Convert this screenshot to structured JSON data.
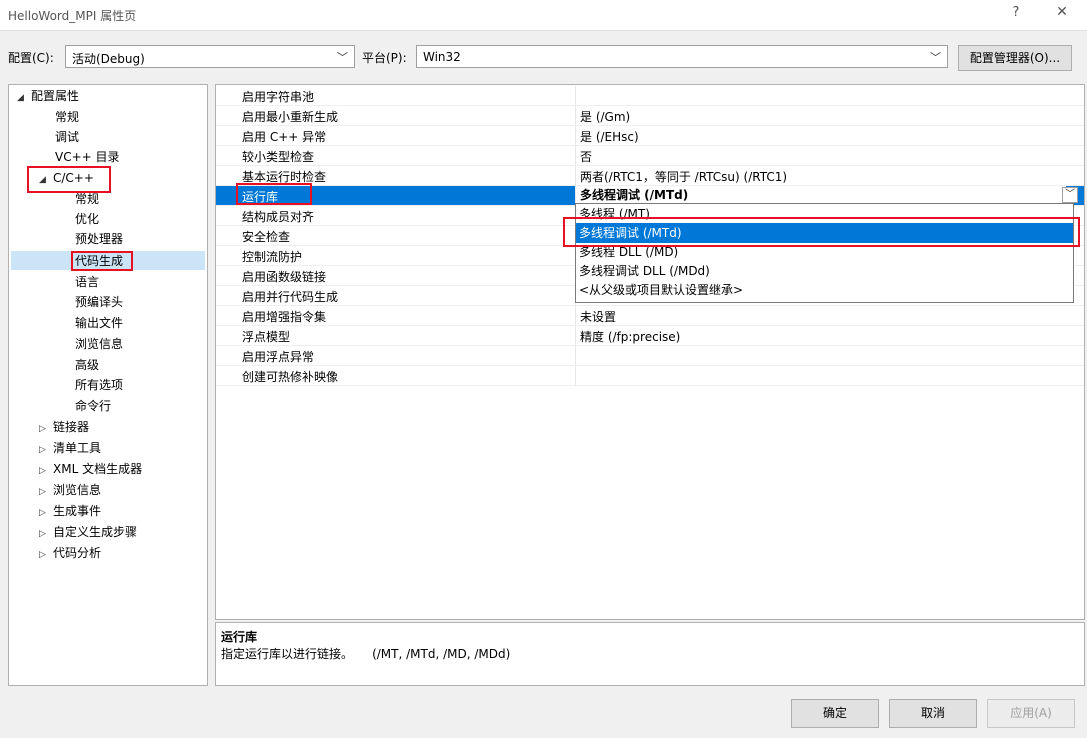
{
  "window": {
    "title": "HelloWord_MPI 属性页",
    "help": "?",
    "close": "✕"
  },
  "config_bar": {
    "config_label": "配置(C):",
    "config_value": "活动(Debug)",
    "platform_label": "平台(P):",
    "platform_value": "Win32",
    "manager_button": "配置管理器(O)..."
  },
  "tree": {
    "root": "配置属性",
    "general": "常规",
    "debugging": "调试",
    "vc_dirs": "VC++ 目录",
    "cpp": "C/C++",
    "cpp_children": [
      "常规",
      "优化",
      "预处理器",
      "代码生成",
      "语言",
      "预编译头",
      "输出文件",
      "浏览信息",
      "高级",
      "所有选项",
      "命令行"
    ],
    "collapsed": [
      "链接器",
      "清单工具",
      "XML 文档生成器",
      "浏览信息",
      "生成事件",
      "自定义生成步骤",
      "代码分析"
    ],
    "selected": "代码生成"
  },
  "grid": {
    "rows": [
      {
        "name": "启用字符串池",
        "value": ""
      },
      {
        "name": "启用最小重新生成",
        "value": "是 (/Gm)"
      },
      {
        "name": "启用 C++ 异常",
        "value": "是 (/EHsc)"
      },
      {
        "name": "较小类型检查",
        "value": "否"
      },
      {
        "name": "基本运行时检查",
        "value": "两者(/RTC1，等同于 /RTCsu) (/RTC1)"
      },
      {
        "name": "运行库",
        "value": "多线程调试 (/MTd)"
      },
      {
        "name": "结构成员对齐",
        "value": ""
      },
      {
        "name": "安全检查",
        "value": ""
      },
      {
        "name": "控制流防护",
        "value": ""
      },
      {
        "name": "启用函数级链接",
        "value": ""
      },
      {
        "name": "启用并行代码生成",
        "value": ""
      },
      {
        "name": "启用增强指令集",
        "value": "未设置"
      },
      {
        "name": "浮点模型",
        "value": "精度 (/fp:precise)"
      },
      {
        "name": "启用浮点异常",
        "value": ""
      },
      {
        "name": "创建可热修补映像",
        "value": ""
      }
    ]
  },
  "dropdown": {
    "options": [
      "多线程 (/MT)",
      "多线程调试 (/MTd)",
      "多线程 DLL (/MD)",
      "多线程调试 DLL (/MDd)",
      "<从父级或项目默认设置继承>"
    ],
    "selected_index": 1
  },
  "description": {
    "title": "运行库",
    "text": "指定运行库以进行链接。     (/MT, /MTd, /MD, /MDd)"
  },
  "buttons": {
    "ok": "确定",
    "cancel": "取消",
    "apply": "应用(A)"
  },
  "colors": {
    "selection": "#0078d7",
    "highlight_box": "#e81123"
  }
}
